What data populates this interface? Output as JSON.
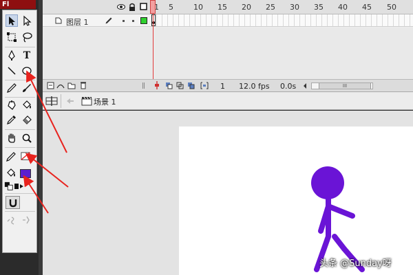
{
  "app_badge": "Fl",
  "tools": [
    {
      "name": "selection-tool",
      "selected": true
    },
    {
      "name": "subselection-tool"
    },
    {
      "name": "free-transform-tool"
    },
    {
      "name": "lasso-tool"
    },
    {
      "name": "pen-tool"
    },
    {
      "name": "text-tool",
      "glyph": "T"
    },
    {
      "name": "line-tool"
    },
    {
      "name": "oval-tool"
    },
    {
      "name": "pencil-tool"
    },
    {
      "name": "brush-tool"
    },
    {
      "name": "ink-bottle-tool"
    },
    {
      "name": "paint-bucket-tool"
    },
    {
      "name": "eyedropper-tool"
    },
    {
      "name": "eraser-tool"
    },
    {
      "name": "hand-tool"
    },
    {
      "name": "zoom-tool"
    }
  ],
  "colors": {
    "stroke_color": "none",
    "fill_color": "#5a1fd0",
    "figure_color": "#6a14d6",
    "annotation_arrow": "#e8231e",
    "playhead": "#e23a3a"
  },
  "timeline": {
    "frame_numbers": [
      "1",
      "5",
      "10",
      "15",
      "20",
      "25",
      "30",
      "35",
      "40",
      "45",
      "50"
    ],
    "layer_name": "图层 1",
    "current_frame": "1",
    "frame_rate": "12.0 fps",
    "elapsed_time": "0.0s",
    "scroll_thumb_label": "III"
  },
  "editbar": {
    "scene_name": "场景 1"
  },
  "watermark": "头条 @Sunday呀"
}
